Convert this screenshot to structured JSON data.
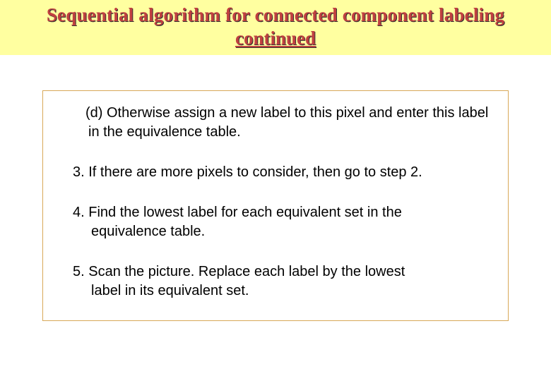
{
  "header": {
    "title_line1": "Sequential algorithm for connected component labeling",
    "title_line2": "continued"
  },
  "content": {
    "item_d": "(d) Otherwise assign a new label to this pixel and enter this label in the equivalence table.",
    "item_3": "3. If there are more pixels to consider, then go to step 2.",
    "item_4_a": "4. Find the lowest label for each equivalent set in the",
    "item_4_b": "equivalence table.",
    "item_5_a": "5. Scan the picture. Replace each label by the lowest",
    "item_5_b": "label in its equivalent set."
  }
}
